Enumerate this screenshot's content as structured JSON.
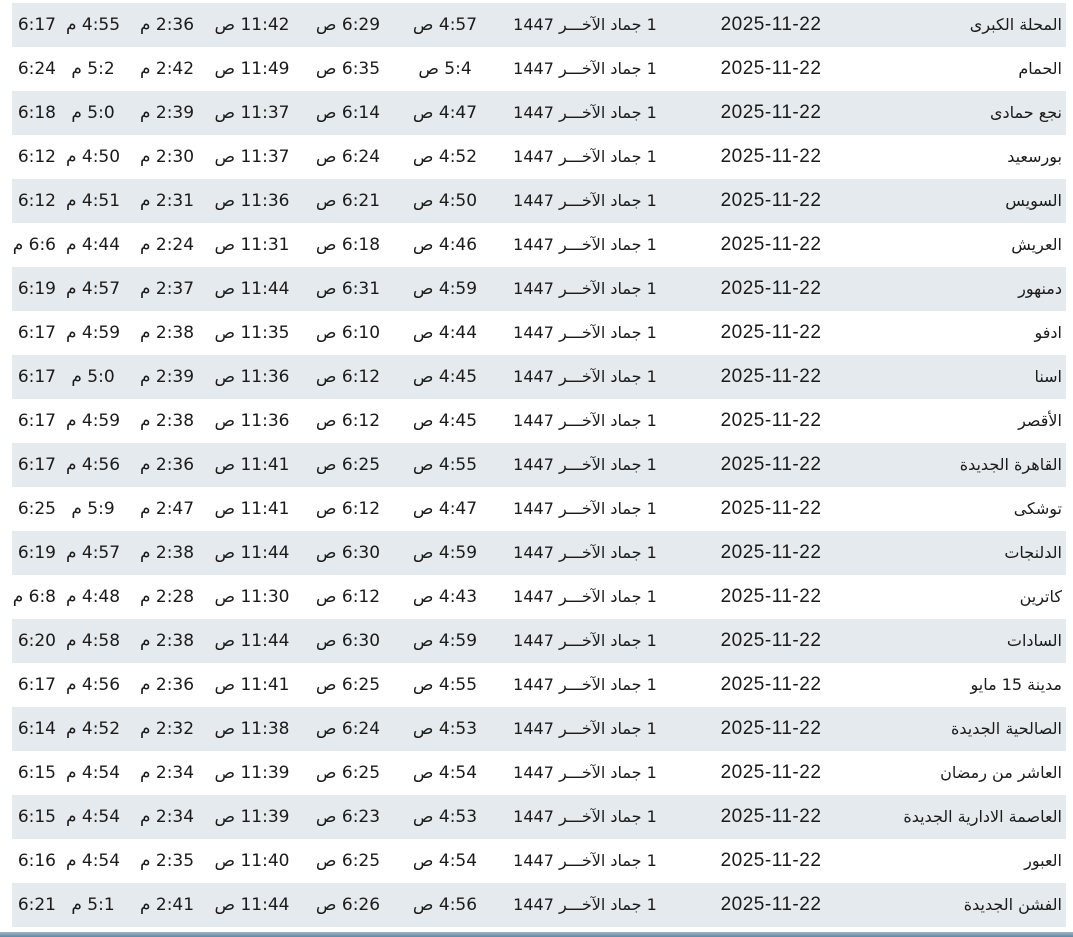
{
  "columns": [
    "city",
    "gregorian_date",
    "hijri_date",
    "fajr",
    "sunrise",
    "dhuhr",
    "asr",
    "maghrib",
    "isha"
  ],
  "rows": [
    {
      "city": "المحلة الكبرى",
      "greg": "2025-11-22",
      "hijri": "1 جماد الآخـــر 1447",
      "fajr": "4:57 ص",
      "sunrise": "6:29 ص",
      "dhuhr": "11:42 ص",
      "asr": "2:36 م",
      "maghrib": "4:55 م",
      "isha": "6:17 م"
    },
    {
      "city": "الحمام",
      "greg": "2025-11-22",
      "hijri": "1 جماد الآخـــر 1447",
      "fajr": "5:4 ص",
      "sunrise": "6:35 ص",
      "dhuhr": "11:49 ص",
      "asr": "2:42 م",
      "maghrib": "5:2 م",
      "isha": "6:24 م"
    },
    {
      "city": "نجع حمادى",
      "greg": "2025-11-22",
      "hijri": "1 جماد الآخـــر 1447",
      "fajr": "4:47 ص",
      "sunrise": "6:14 ص",
      "dhuhr": "11:37 ص",
      "asr": "2:39 م",
      "maghrib": "5:0 م",
      "isha": "6:18 م"
    },
    {
      "city": "بورسعيد",
      "greg": "2025-11-22",
      "hijri": "1 جماد الآخـــر 1447",
      "fajr": "4:52 ص",
      "sunrise": "6:24 ص",
      "dhuhr": "11:37 ص",
      "asr": "2:30 م",
      "maghrib": "4:50 م",
      "isha": "6:12 م"
    },
    {
      "city": "السويس",
      "greg": "2025-11-22",
      "hijri": "1 جماد الآخـــر 1447",
      "fajr": "4:50 ص",
      "sunrise": "6:21 ص",
      "dhuhr": "11:36 ص",
      "asr": "2:31 م",
      "maghrib": "4:51 م",
      "isha": "6:12 م"
    },
    {
      "city": "العريش",
      "greg": "2025-11-22",
      "hijri": "1 جماد الآخـــر 1447",
      "fajr": "4:46 ص",
      "sunrise": "6:18 ص",
      "dhuhr": "11:31 ص",
      "asr": "2:24 م",
      "maghrib": "4:44 م",
      "isha": "6:6 م"
    },
    {
      "city": "دمنهور",
      "greg": "2025-11-22",
      "hijri": "1 جماد الآخـــر 1447",
      "fajr": "4:59 ص",
      "sunrise": "6:31 ص",
      "dhuhr": "11:44 ص",
      "asr": "2:37 م",
      "maghrib": "4:57 م",
      "isha": "6:19 م"
    },
    {
      "city": "ادفو",
      "greg": "2025-11-22",
      "hijri": "1 جماد الآخـــر 1447",
      "fajr": "4:44 ص",
      "sunrise": "6:10 ص",
      "dhuhr": "11:35 ص",
      "asr": "2:38 م",
      "maghrib": "4:59 م",
      "isha": "6:17 م"
    },
    {
      "city": "اسنا",
      "greg": "2025-11-22",
      "hijri": "1 جماد الآخـــر 1447",
      "fajr": "4:45 ص",
      "sunrise": "6:12 ص",
      "dhuhr": "11:36 ص",
      "asr": "2:39 م",
      "maghrib": "5:0 م",
      "isha": "6:17 م"
    },
    {
      "city": "الأقصر",
      "greg": "2025-11-22",
      "hijri": "1 جماد الآخـــر 1447",
      "fajr": "4:45 ص",
      "sunrise": "6:12 ص",
      "dhuhr": "11:36 ص",
      "asr": "2:38 م",
      "maghrib": "4:59 م",
      "isha": "6:17 م"
    },
    {
      "city": "القاهرة الجديدة",
      "greg": "2025-11-22",
      "hijri": "1 جماد الآخـــر 1447",
      "fajr": "4:55 ص",
      "sunrise": "6:25 ص",
      "dhuhr": "11:41 ص",
      "asr": "2:36 م",
      "maghrib": "4:56 م",
      "isha": "6:17 م"
    },
    {
      "city": "توشكى",
      "greg": "2025-11-22",
      "hijri": "1 جماد الآخـــر 1447",
      "fajr": "4:47 ص",
      "sunrise": "6:12 ص",
      "dhuhr": "11:41 ص",
      "asr": "2:47 م",
      "maghrib": "5:9 م",
      "isha": "6:25 م"
    },
    {
      "city": "الدلنجات",
      "greg": "2025-11-22",
      "hijri": "1 جماد الآخـــر 1447",
      "fajr": "4:59 ص",
      "sunrise": "6:30 ص",
      "dhuhr": "11:44 ص",
      "asr": "2:38 م",
      "maghrib": "4:57 م",
      "isha": "6:19 م"
    },
    {
      "city": "كاترين",
      "greg": "2025-11-22",
      "hijri": "1 جماد الآخـــر 1447",
      "fajr": "4:43 ص",
      "sunrise": "6:12 ص",
      "dhuhr": "11:30 ص",
      "asr": "2:28 م",
      "maghrib": "4:48 م",
      "isha": "6:8 م"
    },
    {
      "city": "السادات",
      "greg": "2025-11-22",
      "hijri": "1 جماد الآخـــر 1447",
      "fajr": "4:59 ص",
      "sunrise": "6:30 ص",
      "dhuhr": "11:44 ص",
      "asr": "2:38 م",
      "maghrib": "4:58 م",
      "isha": "6:20 م"
    },
    {
      "city": "مدينة 15 مايو",
      "greg": "2025-11-22",
      "hijri": "1 جماد الآخـــر 1447",
      "fajr": "4:55 ص",
      "sunrise": "6:25 ص",
      "dhuhr": "11:41 ص",
      "asr": "2:36 م",
      "maghrib": "4:56 م",
      "isha": "6:17 م"
    },
    {
      "city": "الصالحية الجديدة",
      "greg": "2025-11-22",
      "hijri": "1 جماد الآخـــر 1447",
      "fajr": "4:53 ص",
      "sunrise": "6:24 ص",
      "dhuhr": "11:38 ص",
      "asr": "2:32 م",
      "maghrib": "4:52 م",
      "isha": "6:14 م"
    },
    {
      "city": "العاشر من رمضان",
      "greg": "2025-11-22",
      "hijri": "1 جماد الآخـــر 1447",
      "fajr": "4:54 ص",
      "sunrise": "6:25 ص",
      "dhuhr": "11:39 ص",
      "asr": "2:34 م",
      "maghrib": "4:54 م",
      "isha": "6:15 م"
    },
    {
      "city": "العاصمة الادارية الجديدة",
      "greg": "2025-11-22",
      "hijri": "1 جماد الآخـــر 1447",
      "fajr": "4:53 ص",
      "sunrise": "6:23 ص",
      "dhuhr": "11:39 ص",
      "asr": "2:34 م",
      "maghrib": "4:54 م",
      "isha": "6:15 م"
    },
    {
      "city": "العبور",
      "greg": "2025-11-22",
      "hijri": "1 جماد الآخـــر 1447",
      "fajr": "4:54 ص",
      "sunrise": "6:25 ص",
      "dhuhr": "11:40 ص",
      "asr": "2:35 م",
      "maghrib": "4:54 م",
      "isha": "6:16 م"
    },
    {
      "city": "الفشن الجديدة",
      "greg": "2025-11-22",
      "hijri": "1 جماد الآخـــر 1447",
      "fajr": "4:56 ص",
      "sunrise": "6:26 ص",
      "dhuhr": "11:44 ص",
      "asr": "2:41 م",
      "maghrib": "5:1 م",
      "isha": "6:21 م"
    }
  ]
}
